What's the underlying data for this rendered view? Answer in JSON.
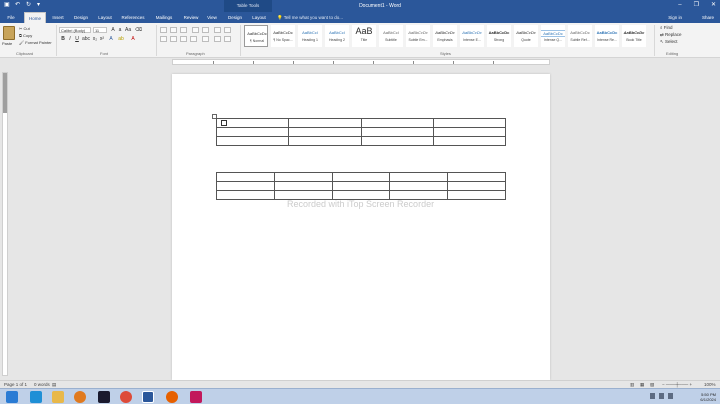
{
  "titlebar": {
    "table_tools": "Table Tools",
    "doc_title": "Document1 - Word",
    "controls": [
      "–",
      "❐",
      "✕"
    ]
  },
  "tabs": [
    "File",
    "Home",
    "Insert",
    "Design",
    "Layout",
    "References",
    "Mailings",
    "Review",
    "View",
    "Design",
    "Layout"
  ],
  "active_tab": "Home",
  "tell_me": "Tell me what you want to do...",
  "sign_in": "Sign in",
  "share": "Share",
  "ribbon": {
    "clipboard": {
      "paste": "Paste",
      "cut": "Cut",
      "copy": "Copy",
      "format_painter": "Format Painter",
      "label": "Clipboard"
    },
    "font": {
      "family": "Calibri (Body)",
      "size": "11",
      "label": "Font"
    },
    "paragraph_label": "Paragraph",
    "styles": {
      "label": "Styles",
      "items": [
        {
          "sample": "AaBbCcDc",
          "name": "¶ Normal"
        },
        {
          "sample": "AaBbCcDc",
          "name": "¶ No Spac..."
        },
        {
          "sample": "AaBbCcI",
          "name": "Heading 1"
        },
        {
          "sample": "AaBbCcI",
          "name": "Heading 2"
        },
        {
          "sample": "AaB",
          "name": "Title"
        },
        {
          "sample": "AaBbCcI",
          "name": "Subtitle"
        },
        {
          "sample": "AaBbCcDc",
          "name": "Subtle Em..."
        },
        {
          "sample": "AaBbCcDc",
          "name": "Emphasis"
        },
        {
          "sample": "AaBbCcDc",
          "name": "Intense E..."
        },
        {
          "sample": "AaBbCcDc",
          "name": "Strong"
        },
        {
          "sample": "AaBbCcDc",
          "name": "Quote"
        },
        {
          "sample": "AaBbCcDc",
          "name": "Intense Q..."
        },
        {
          "sample": "AaBbCcDc",
          "name": "Subtle Ref..."
        },
        {
          "sample": "AaBbCcDc",
          "name": "Intense Re..."
        },
        {
          "sample": "AaBbCcDc",
          "name": "Book Title"
        }
      ]
    },
    "editing": {
      "find": "Find",
      "replace": "Replace",
      "select": "Select",
      "label": "Editing"
    }
  },
  "document": {
    "watermark": "Recorded with iTop Screen Recorder",
    "table1": {
      "rows": 3,
      "cols": 4
    },
    "table2": {
      "rows": 3,
      "cols": 5
    }
  },
  "status": {
    "page": "Page 1 of 1",
    "words": "0 words",
    "zoom": "100%"
  },
  "taskbar": {
    "apps": [
      "start",
      "ie",
      "explorer",
      "media",
      "zoom",
      "chrome",
      "word",
      "firefox",
      "recorder"
    ],
    "time": "5:50 PM",
    "date": "6/1/2024"
  }
}
